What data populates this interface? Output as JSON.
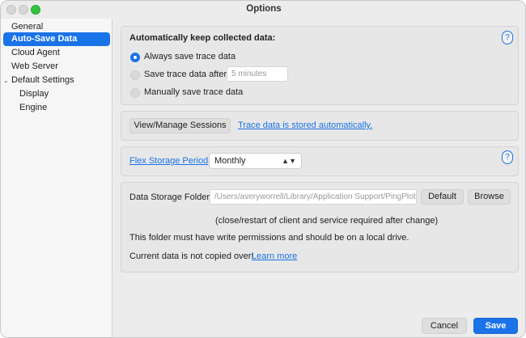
{
  "window": {
    "title": "Options"
  },
  "sidebar": {
    "items": [
      {
        "label": "General"
      },
      {
        "label": "Auto-Save Data"
      },
      {
        "label": "Cloud Agent"
      },
      {
        "label": "Web Server"
      },
      {
        "label": "Default Settings"
      },
      {
        "label": "Display"
      },
      {
        "label": "Engine"
      }
    ]
  },
  "autosave": {
    "heading": "Automatically keep collected data:",
    "help": "?",
    "option_always": "Always save trace data",
    "option_after": "Save trace data after",
    "after_placeholder": "5 minutes",
    "option_manual": "Manually save trace data"
  },
  "sessions": {
    "button": "View/Manage Sessions",
    "link": "Trace data is stored automatically."
  },
  "flex": {
    "link": "Flex Storage Period",
    "value": "Monthly",
    "help": "?"
  },
  "storage": {
    "folder_label": "Data Storage Folder:",
    "folder_path": "/Users/averyworrell/Library/Application Support/PingPlotter",
    "default_button": "Default",
    "browse_button": "Browse",
    "restart_note": "(close/restart of client and service required after change)",
    "permissions_note": "This folder must have write permissions and should be on a local drive.",
    "copy_note": "Current data is not copied over!",
    "learn_more": "Learn more"
  },
  "footer": {
    "cancel": "Cancel",
    "save": "Save"
  }
}
